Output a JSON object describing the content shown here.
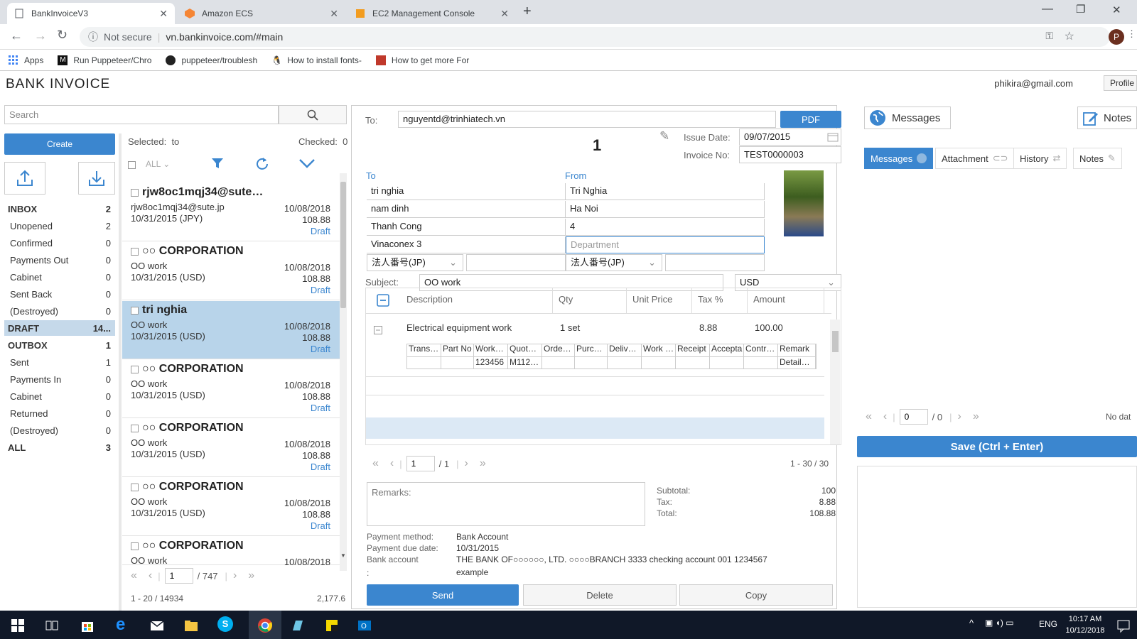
{
  "browser": {
    "tabs": [
      {
        "title": "BankInvoiceV3",
        "active": true
      },
      {
        "title": "Amazon ECS",
        "active": false
      },
      {
        "title": "EC2 Management Console",
        "active": false
      }
    ],
    "security": "Not secure",
    "url": "vn.bankinvoice.com/#main",
    "profile_initial": "P",
    "bookmarks": [
      "Apps",
      "Run Puppeteer/Chro",
      "puppeteer/troublesh",
      "How to install fonts-",
      "How to get more For"
    ]
  },
  "app": {
    "logo": "BANK INVOICE",
    "user_email": "phikira@gmail.com",
    "profile_label": "Profile",
    "search_placeholder": "Search",
    "create_label": "Create"
  },
  "folders": [
    {
      "name": "INBOX",
      "count": "2",
      "bold": true
    },
    {
      "name": "Unopened",
      "count": "2"
    },
    {
      "name": "Confirmed",
      "count": "0"
    },
    {
      "name": "Payments Out",
      "count": "0"
    },
    {
      "name": "Cabinet",
      "count": "0"
    },
    {
      "name": "Sent Back",
      "count": "0"
    },
    {
      "name": "(Destroyed)",
      "count": "0"
    },
    {
      "name": "DRAFT",
      "count": "14...",
      "bold": true,
      "selected": true
    },
    {
      "name": "OUTBOX",
      "count": "1",
      "bold": true
    },
    {
      "name": "Sent",
      "count": "1"
    },
    {
      "name": "Payments In",
      "count": "0"
    },
    {
      "name": "Cabinet",
      "count": "0"
    },
    {
      "name": "Returned",
      "count": "0"
    },
    {
      "name": "(Destroyed)",
      "count": "0"
    },
    {
      "name": "ALL",
      "count": "3",
      "bold": true
    }
  ],
  "list": {
    "selected_label": "Selected:",
    "selected_value": "to",
    "checked_label": "Checked:",
    "checked_value": "0",
    "all_label": "ALL",
    "items": [
      {
        "from": "rjw8oc1mqj34@sute…",
        "subject": "rjw8oc1mqj34@sute.jp",
        "due": "10/31/2015 (JPY)",
        "date": "10/08/2018",
        "amount": "108.88",
        "status": "Draft",
        "selected": false
      },
      {
        "from": "○○ CORPORATION",
        "subject": "OO work",
        "due": "10/31/2015 (USD)",
        "date": "10/08/2018",
        "amount": "108.88",
        "status": "Draft",
        "selected": false
      },
      {
        "from": "tri nghia",
        "subject": "OO work",
        "due": "10/31/2015 (USD)",
        "date": "10/08/2018",
        "amount": "108.88",
        "status": "Draft",
        "selected": true
      },
      {
        "from": "○○ CORPORATION",
        "subject": "OO work",
        "due": "10/31/2015 (USD)",
        "date": "10/08/2018",
        "amount": "108.88",
        "status": "Draft",
        "selected": false
      },
      {
        "from": "○○ CORPORATION",
        "subject": "OO work",
        "due": "10/31/2015 (USD)",
        "date": "10/08/2018",
        "amount": "108.88",
        "status": "Draft",
        "selected": false
      },
      {
        "from": "○○ CORPORATION",
        "subject": "OO work",
        "due": "10/31/2015 (USD)",
        "date": "10/08/2018",
        "amount": "108.88",
        "status": "Draft",
        "selected": false
      },
      {
        "from": "○○ CORPORATION",
        "subject": "OO work",
        "due": "",
        "date": "10/08/2018",
        "amount": "",
        "status": "",
        "selected": false
      }
    ],
    "page": "1",
    "page_total": "/ 747",
    "range": "1 - 20 / 14934",
    "sum": "2,177.6"
  },
  "invoice": {
    "to_label": "To:",
    "to_value": "nguyentd@trinhiatech.vn",
    "pdf_label": "PDF",
    "number": "1",
    "issue_date_label": "Issue Date:",
    "issue_date": "09/07/2015",
    "invoice_no_label": "Invoice No:",
    "invoice_no": "TEST0000003",
    "to_heading": "To",
    "from_heading": "From",
    "to_lines": [
      "tri nghia",
      "nam dinh",
      "Thanh Cong",
      "Vinaconex 3"
    ],
    "from_lines": [
      "Tri Nghia",
      "Ha Noi",
      "4",
      ""
    ],
    "from_dept_placeholder": "Department",
    "corp_no_label": "法人番号(JP)",
    "subject_label": "Subject:",
    "subject": "OO work",
    "currency": "USD",
    "columns": [
      "Description",
      "Qty",
      "Unit Price",
      "Tax %",
      "Amount"
    ],
    "line": {
      "description": "Electrical equipment work",
      "qty": "1 set",
      "tax": "8.88",
      "amount": "100.00"
    },
    "sub_headers": [
      "Trans…",
      "Part No",
      "Work…",
      "Quot…",
      "Orde…",
      "Purc…",
      "Deliv…",
      "Work …",
      "Receipt",
      "Accepta",
      "Contr…",
      "Remark"
    ],
    "sub_values": [
      "",
      "",
      "123456",
      "M112…",
      "",
      "",
      "",
      "",
      "",
      "",
      "",
      "Detail…"
    ],
    "page": "1",
    "page_total": "/ 1",
    "range": "1 - 30 / 30",
    "remarks_label": "Remarks:",
    "subtotal_label": "Subtotal:",
    "subtotal": "100",
    "tax_label": "Tax:",
    "tax": "8.88",
    "total_label": "Total:",
    "total": "108.88",
    "payment_method_label": "Payment method:",
    "payment_method": "Bank Account",
    "due_label": "Payment due date:",
    "due": "10/31/2015",
    "bank_label": "Bank account",
    "bank_value": "THE BANK OF○○○○○○, LTD. ○○○○BRANCH 3333 checking account 001 1234567",
    "bank_value2": "example",
    "bank_colon": ":",
    "send_label": "Send",
    "delete_label": "Delete",
    "copy_label": "Copy"
  },
  "right": {
    "messages_btn": "Messages",
    "notes_btn": "Notes",
    "tabs": [
      "Messages",
      "Attachment",
      "History",
      "Notes"
    ],
    "page": "0",
    "page_total": "/ 0",
    "no_data": "No dat",
    "save_label": "Save (Ctrl + Enter)"
  },
  "taskbar": {
    "lang": "ENG",
    "time": "10:17 AM",
    "date": "10/12/2018"
  },
  "colors": {
    "accent": "#3b86cf",
    "selected_row": "#b8d4ea",
    "taskbar": "#101828"
  }
}
